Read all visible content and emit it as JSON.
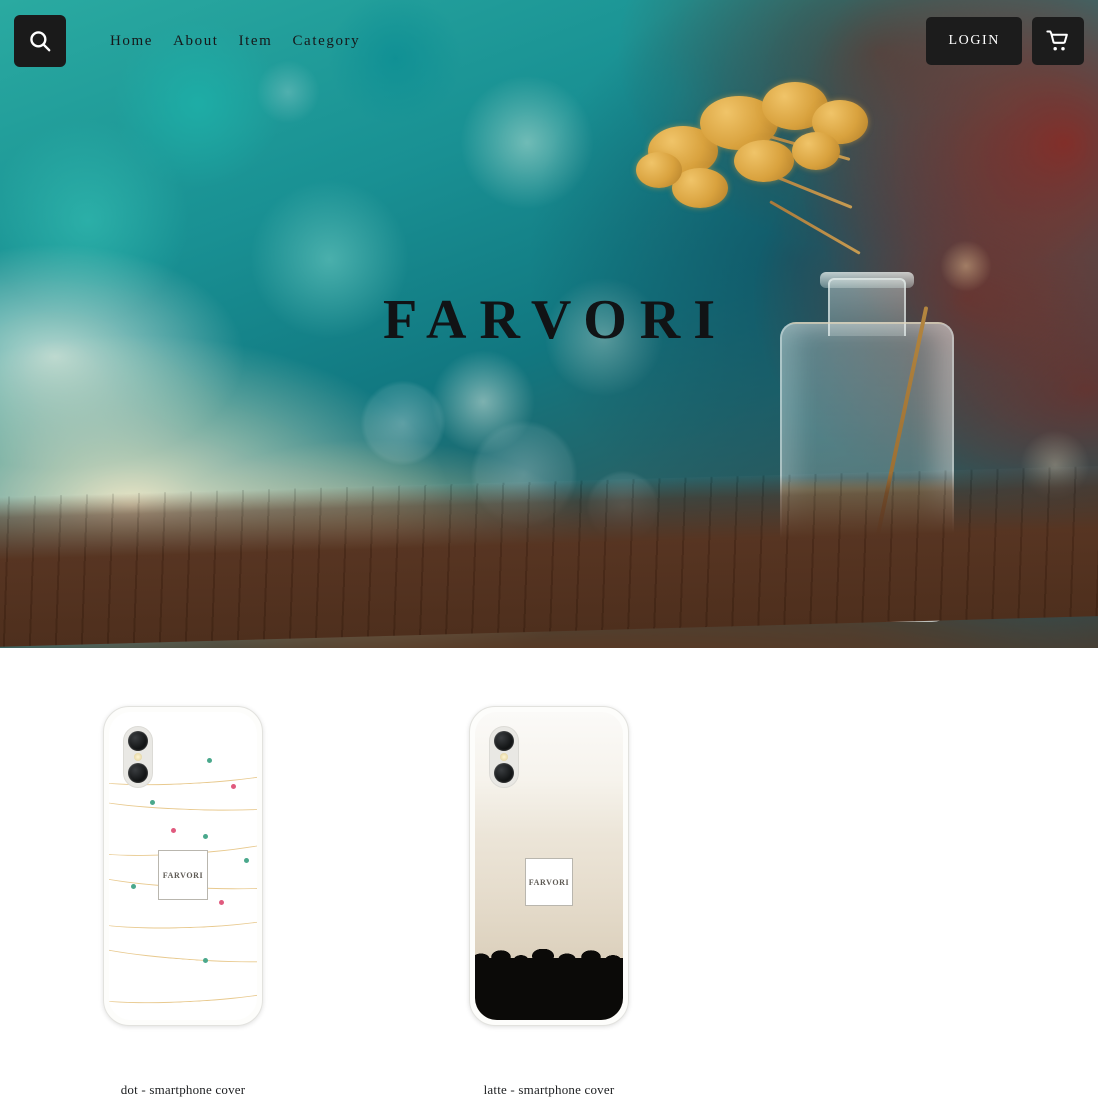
{
  "site": {
    "brand": "FARVORI"
  },
  "header": {
    "search_icon": "search-icon",
    "nav": [
      {
        "label": "Home"
      },
      {
        "label": "About"
      },
      {
        "label": "Item"
      },
      {
        "label": "Category"
      }
    ],
    "login_label": "LOGIN",
    "cart_icon": "shopping-cart-icon"
  },
  "hero": {
    "title": "FARVORI",
    "image_alt": "dried golden flowers in a glass bottle on a wooden table with teal painted background"
  },
  "products": [
    {
      "name": "dot - smartphone cover",
      "case_logo": "FARVORI",
      "style": "dot"
    },
    {
      "name": "latte - smartphone cover",
      "case_logo": "FARVORI",
      "style": "latte"
    }
  ],
  "colors": {
    "button_dark": "#1c1c1c",
    "button_text": "#ffffff",
    "nav_text": "#16181a",
    "hero_title": "#111315",
    "page_background": "#ffffff",
    "hero_teal": "#1d8f92",
    "hero_cream": "#f7ecCB",
    "hero_rust": "#962018",
    "case_gold_line": "#e8c98e",
    "case_dot_pink": "#e05a7e",
    "case_dot_green": "#4aa88c",
    "case_ink_black": "#0b0a08"
  }
}
